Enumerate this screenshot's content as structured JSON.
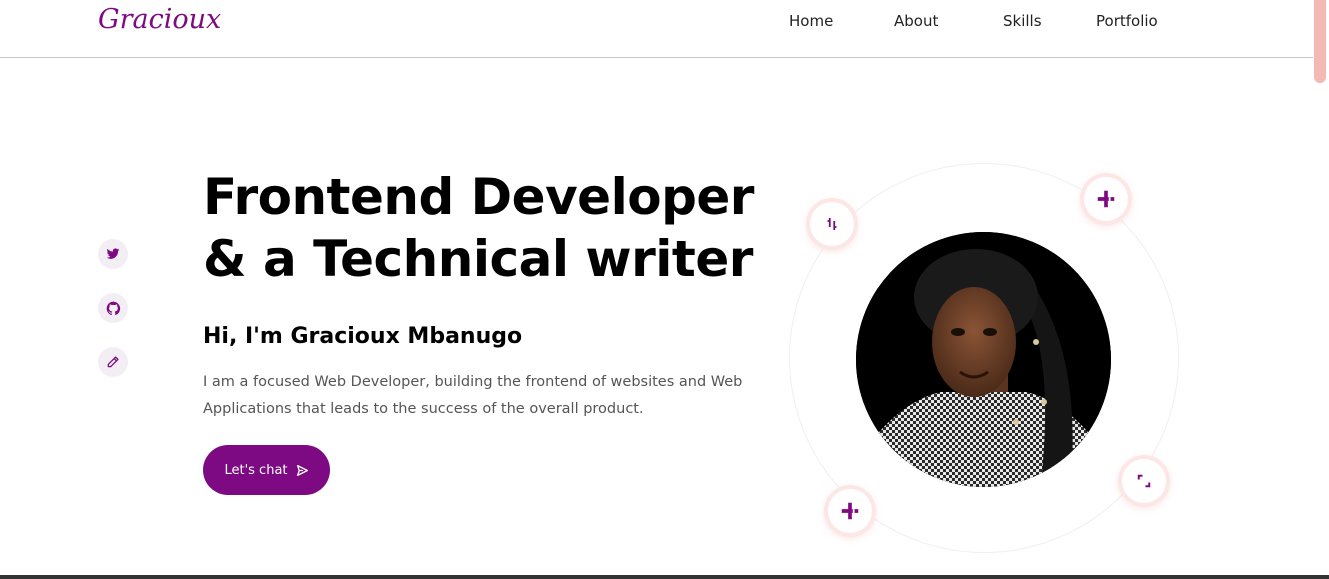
{
  "brand": {
    "logo_text": "Gracioux",
    "accent": "#7d0a82"
  },
  "nav": {
    "items": [
      "Home",
      "About",
      "Skills",
      "Portfolio"
    ]
  },
  "social": [
    {
      "icon": "twitter-icon"
    },
    {
      "icon": "github-icon"
    },
    {
      "icon": "pencil-icon"
    }
  ],
  "hero": {
    "title_line1": "Frontend Developer",
    "title_line2": "& a Technical writer",
    "subtitle": "Hi, I'm Gracioux Mbanugo",
    "description": "I am a focused Web Developer, building the frontend of websites and Web Applications that leads to the success of the overall product.",
    "cta_label": "Let's chat"
  },
  "orbit_icons": [
    "code-bracket-icon",
    "plus-cross-icon",
    "plus-cross-icon",
    "frame-corner-icon"
  ]
}
